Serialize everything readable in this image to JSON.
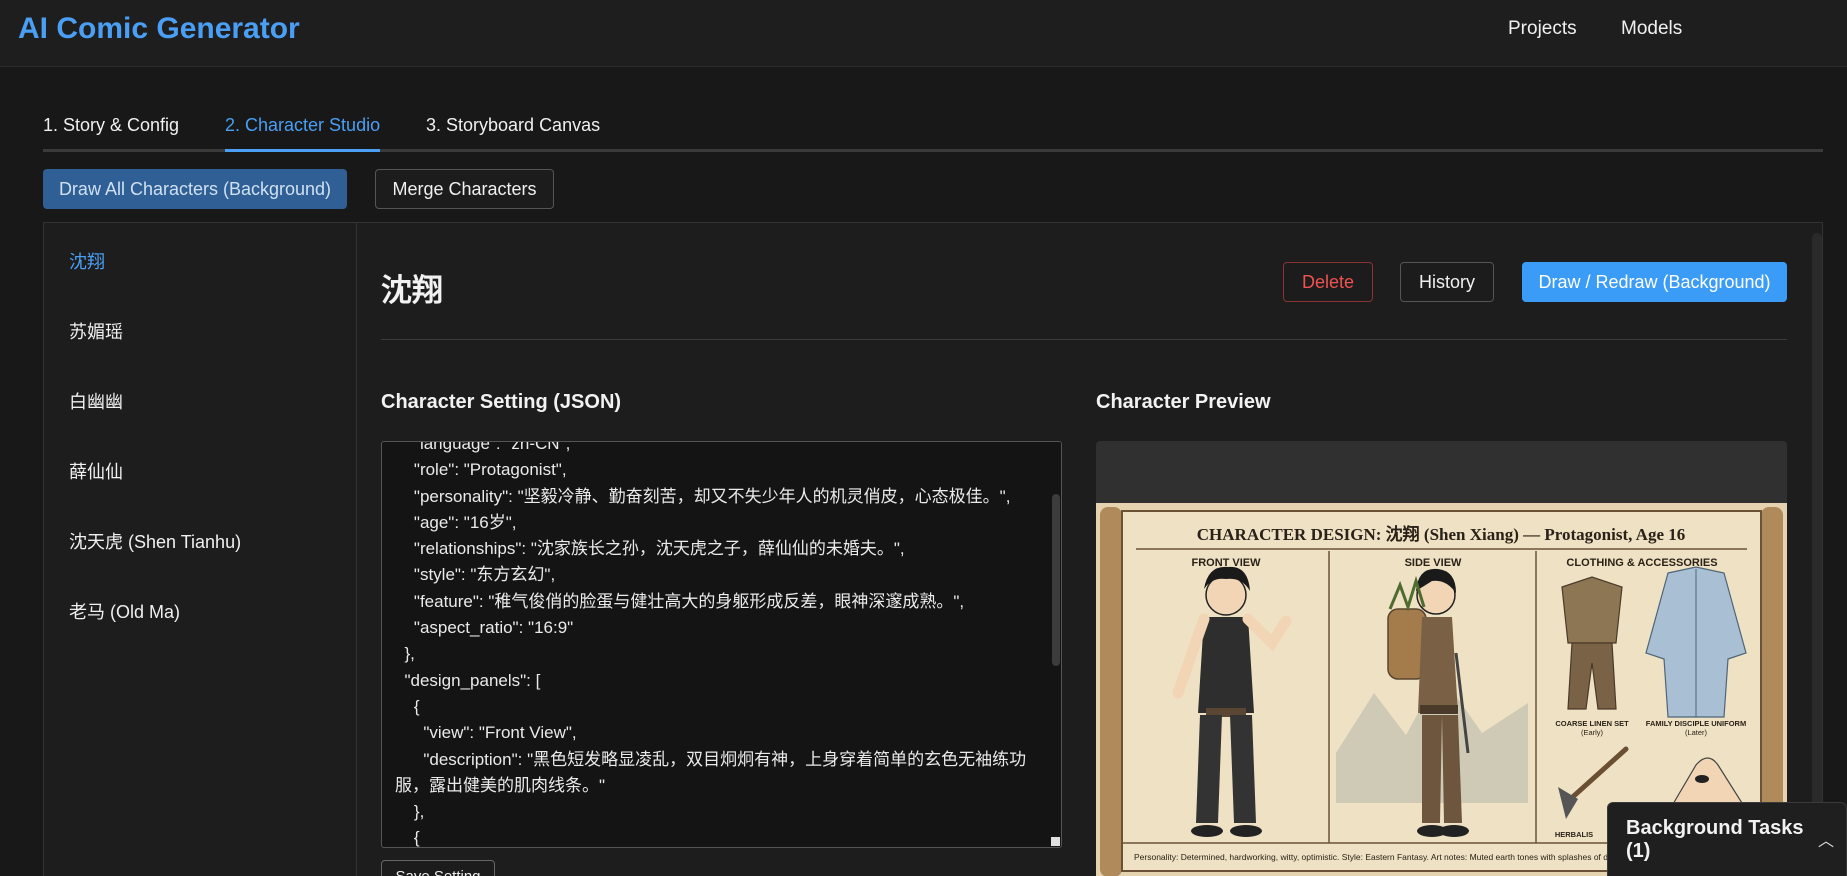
{
  "app": {
    "title": "AI Comic Generator"
  },
  "nav": {
    "projects": "Projects",
    "models": "Models"
  },
  "tabs": [
    {
      "label": "1. Story & Config"
    },
    {
      "label": "2. Character Studio"
    },
    {
      "label": "3. Storyboard Canvas"
    }
  ],
  "toolbar": {
    "draw_all": "Draw All Characters (Background)",
    "merge": "Merge Characters"
  },
  "characters": [
    {
      "name": "沈翔"
    },
    {
      "name": "苏媚瑶"
    },
    {
      "name": "白幽幽"
    },
    {
      "name": "薛仙仙"
    },
    {
      "name": "沈天虎 (Shen Tianhu)"
    },
    {
      "name": "老马 (Old Ma)"
    }
  ],
  "detail": {
    "name": "沈翔",
    "delete_label": "Delete",
    "history_label": "History",
    "draw_label": "Draw / Redraw (Background)",
    "setting_title": "Character Setting (JSON)",
    "preview_title": "Character Preview",
    "save_label": "Save Setting",
    "json_text": "    \"language\": \"zh-CN\",\n    \"role\": \"Protagonist\",\n    \"personality\": \"坚毅冷静、勤奋刻苦，却又不失少年人的机灵俏皮，心态极佳。\",\n    \"age\": \"16岁\",\n    \"relationships\": \"沈家族长之孙，沈天虎之子，薛仙仙的未婚夫。\",\n    \"style\": \"东方玄幻\",\n    \"feature\": \"稚气俊俏的脸蛋与健壮高大的身躯形成反差，眼神深邃成熟。\",\n    \"aspect_ratio\": \"16:9\"\n  },\n  \"design_panels\": [\n    {\n      \"view\": \"Front View\",\n      \"description\": \"黑色短发略显凌乱，双目炯炯有神，上身穿着简单的玄色无袖练功服，露出健美的肌肉线条。\"\n    },\n    {"
  },
  "preview": {
    "heading": "CHARACTER DESIGN: 沈翔 (Shen Xiang) — Protagonist, Age 16",
    "front_view": "FRONT VIEW",
    "side_view": "SIDE VIEW",
    "clothing": "CLOTHING & ACCESSORIES",
    "item_1": "COARSE LINEN SET",
    "item_1_sub": "(Early)",
    "item_2": "FAMILY DISCIPLE UNIFORM",
    "item_2_sub": "(Later)",
    "item_3": "HERBALIS",
    "caption": "Personality: Determined, hardworking, witty, optimistic. Style: Eastern Fantasy. Art notes: Muted earth tones with splashes of deep blue and"
  },
  "background_tasks": {
    "label": "Background Tasks (1)"
  },
  "colors": {
    "accent": "#4a9ff5",
    "danger": "#f05252",
    "primary": "#3b9cf7"
  }
}
